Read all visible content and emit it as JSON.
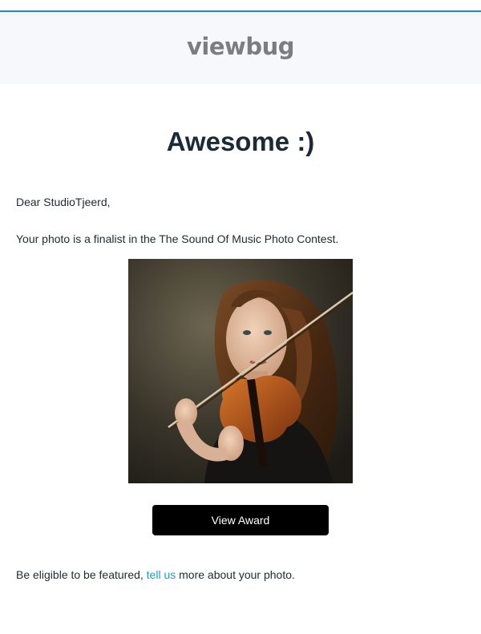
{
  "brand": {
    "logo_text": "viewbug",
    "accent_color": "#2a86c9",
    "link_color": "#1a9ed6"
  },
  "headline": "Awesome :)",
  "greeting": "Dear StudioTjeerd,",
  "message": "Your photo is a finalist in the The Sound Of Music Photo Contest.",
  "photo": {
    "description_icon": "girl-playing-violin-photo"
  },
  "cta": {
    "label": "View Award"
  },
  "footer": {
    "prefix": "Be eligible to be featured, ",
    "link_text": "tell us",
    "suffix": " more about your photo."
  }
}
